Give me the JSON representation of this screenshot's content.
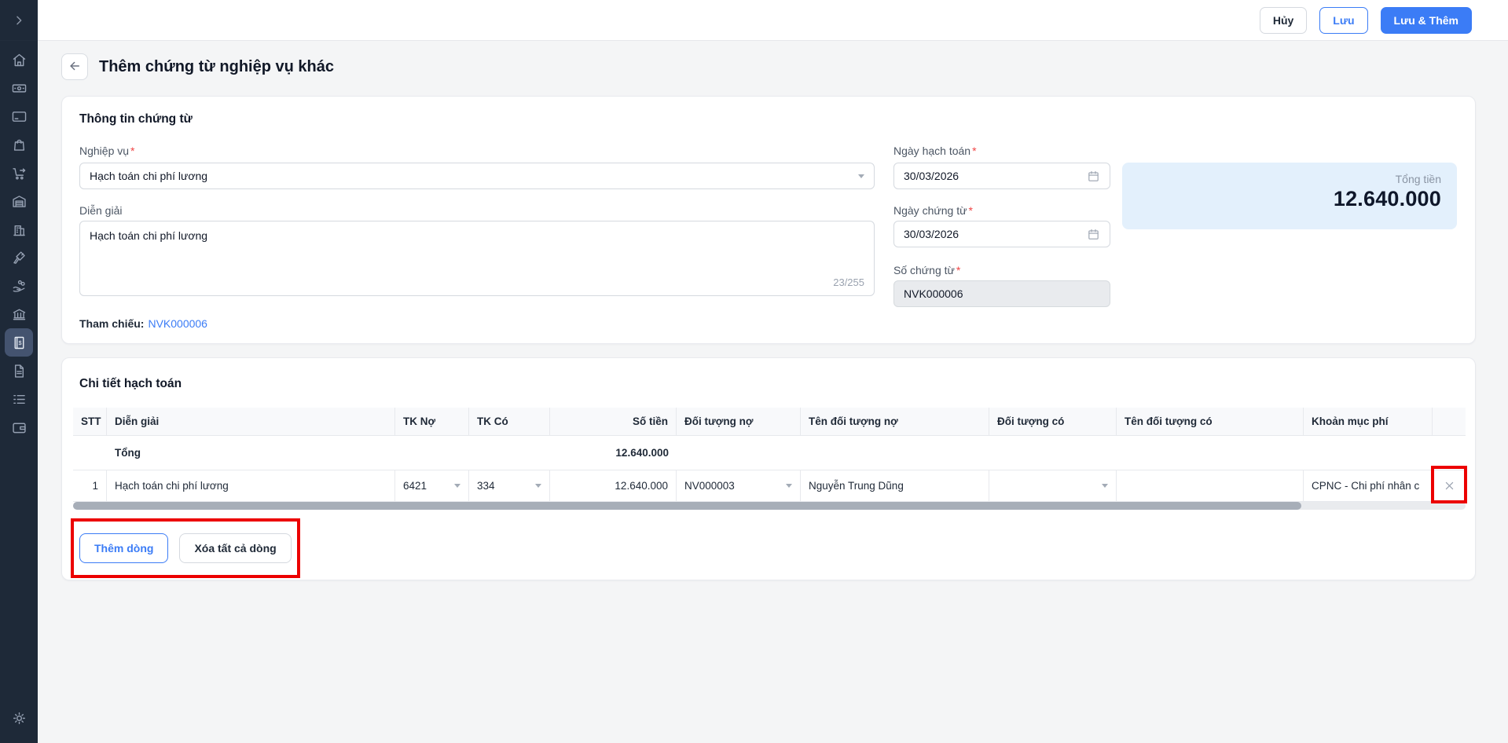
{
  "topbar": {
    "cancel_label": "Hủy",
    "save_label": "Lưu",
    "save_add_label": "Lưu & Thêm"
  },
  "page": {
    "title": "Thêm chứng từ nghiệp vụ khác"
  },
  "required_mark": "*",
  "sidebar": {
    "items": [
      "home",
      "banknote",
      "credit-card",
      "shopping-bag",
      "shopping-cart",
      "warehouse",
      "office-building",
      "tools",
      "hand-coins",
      "bank",
      "cash-book",
      "document",
      "list",
      "wallet"
    ],
    "active": "cash-book",
    "bottom": "settings"
  },
  "doc_info": {
    "heading": "Thông tin chứng từ",
    "nghiep_vu_label": "Nghiệp vụ",
    "nghiep_vu_value": "Hạch toán chi phí lương",
    "dien_giai_label": "Diễn giải",
    "dien_giai_value": "Hạch toán chi phí lương",
    "dien_giai_counter": "23/255",
    "tham_chieu_label": "Tham chiếu:",
    "tham_chieu_value": "NVK000006",
    "ngay_hach_toan_label": "Ngày hạch toán",
    "ngay_hach_toan_value": "30/03/2026",
    "ngay_chung_tu_label": "Ngày chứng từ",
    "ngay_chung_tu_value": "30/03/2026",
    "so_chung_tu_label": "Số chứng từ",
    "so_chung_tu_value": "NVK000006",
    "tong_tien_label": "Tổng tiền",
    "tong_tien_value": "12.640.000"
  },
  "detail": {
    "heading": "Chi tiết hạch toán",
    "table": {
      "headers": [
        "STT",
        "Diễn giải",
        "TK Nợ",
        "TK Có",
        "Số tiền",
        "Đối tượng nợ",
        "Tên đối tượng nợ",
        "Đối tượng có",
        "Tên đối tượng có",
        "Khoản mục phí"
      ],
      "total_label": "Tổng",
      "total_amount": "12.640.000",
      "rows": [
        {
          "stt": "1",
          "dien_giai": "Hạch toán chi phí lương",
          "tk_no": "6421",
          "tk_co": "334",
          "so_tien": "12.640.000",
          "doi_tuong_no": "NV000003",
          "ten_doi_tuong_no": "Nguyễn Trung Dũng",
          "doi_tuong_co": "",
          "ten_doi_tuong_co": "",
          "khoan_muc_phi": "CPNC - Chi phí nhân c"
        }
      ]
    },
    "add_row_label": "Thêm dòng",
    "delete_all_label": "Xóa tất cả dòng"
  },
  "colors": {
    "primary": "#3b7cf6",
    "sidebar_bg": "#1e2938",
    "annotation_red": "#ec0000",
    "total_box_bg": "#e3f0fc"
  }
}
